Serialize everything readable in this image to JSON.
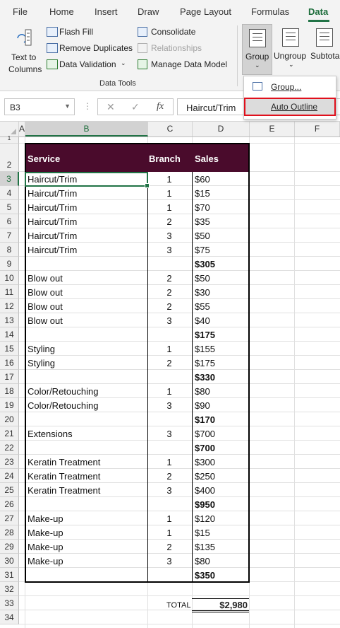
{
  "tabs": [
    "File",
    "Home",
    "Insert",
    "Draw",
    "Page Layout",
    "Formulas",
    "Data"
  ],
  "active_tab": "Data",
  "ribbon": {
    "text_to_columns": [
      "Text to",
      "Columns"
    ],
    "flash_fill": "Flash Fill",
    "remove_duplicates": "Remove Duplicates",
    "data_validation": "Data Validation",
    "consolidate": "Consolidate",
    "relationships": "Relationships",
    "manage_data_model": "Manage Data Model",
    "data_tools_label": "Data Tools",
    "group": "Group",
    "ungroup": "Ungroup",
    "subtotal": "Subtota"
  },
  "menu": {
    "group_item": "Group...",
    "auto_outline": "Auto Outline"
  },
  "formula_bar": {
    "name_box": "B3",
    "cancel": "✕",
    "enter": "✓",
    "fx": "fx",
    "value": "Haircut/Trim"
  },
  "columns": [
    "A",
    "B",
    "C",
    "D",
    "E",
    "F"
  ],
  "row_numbers": [
    "1",
    "2",
    "3",
    "4",
    "5",
    "6",
    "7",
    "8",
    "9",
    "10",
    "11",
    "12",
    "13",
    "14",
    "15",
    "16",
    "17",
    "18",
    "19",
    "20",
    "21",
    "22",
    "23",
    "24",
    "25",
    "26",
    "27",
    "28",
    "29",
    "30",
    "31",
    "32",
    "33",
    "34"
  ],
  "table": {
    "headers": [
      "Service",
      "Branch",
      "Sales"
    ],
    "rows": [
      {
        "service": "Haircut/Trim",
        "branch": "1",
        "sales": "$60"
      },
      {
        "service": "Haircut/Trim",
        "branch": "1",
        "sales": "$15"
      },
      {
        "service": "Haircut/Trim",
        "branch": "1",
        "sales": "$70"
      },
      {
        "service": "Haircut/Trim",
        "branch": "2",
        "sales": "$35"
      },
      {
        "service": "Haircut/Trim",
        "branch": "3",
        "sales": "$50"
      },
      {
        "service": "Haircut/Trim",
        "branch": "3",
        "sales": "$75"
      },
      {
        "service": "",
        "branch": "",
        "sales": "$305",
        "subtotal": true
      },
      {
        "service": "Blow out",
        "branch": "2",
        "sales": "$50"
      },
      {
        "service": "Blow out",
        "branch": "2",
        "sales": "$30"
      },
      {
        "service": "Blow out",
        "branch": "2",
        "sales": "$55"
      },
      {
        "service": "Blow out",
        "branch": "3",
        "sales": "$40"
      },
      {
        "service": "",
        "branch": "",
        "sales": "$175",
        "subtotal": true
      },
      {
        "service": "Styling",
        "branch": "1",
        "sales": "$155"
      },
      {
        "service": "Styling",
        "branch": "2",
        "sales": "$175"
      },
      {
        "service": "",
        "branch": "",
        "sales": "$330",
        "subtotal": true
      },
      {
        "service": "Color/Retouching",
        "branch": "1",
        "sales": "$80"
      },
      {
        "service": "Color/Retouching",
        "branch": "3",
        "sales": "$90"
      },
      {
        "service": "",
        "branch": "",
        "sales": "$170",
        "subtotal": true
      },
      {
        "service": "Extensions",
        "branch": "3",
        "sales": "$700"
      },
      {
        "service": "",
        "branch": "",
        "sales": "$700",
        "subtotal": true
      },
      {
        "service": "Keratin Treatment",
        "branch": "1",
        "sales": "$300"
      },
      {
        "service": "Keratin Treatment",
        "branch": "2",
        "sales": "$250"
      },
      {
        "service": "Keratin Treatment",
        "branch": "3",
        "sales": "$400"
      },
      {
        "service": "",
        "branch": "",
        "sales": "$950",
        "subtotal": true
      },
      {
        "service": "Make-up",
        "branch": "1",
        "sales": "$120"
      },
      {
        "service": "Make-up",
        "branch": "1",
        "sales": "$15"
      },
      {
        "service": "Make-up",
        "branch": "2",
        "sales": "$135"
      },
      {
        "service": "Make-up",
        "branch": "3",
        "sales": "$80"
      },
      {
        "service": "",
        "branch": "",
        "sales": "$350",
        "subtotal": true
      }
    ]
  },
  "total": {
    "label": "TOTAL",
    "value": "$2,980"
  },
  "colors": {
    "header_bg": "#4a0b2c",
    "accent": "#217346",
    "highlight": "#e0101c"
  }
}
